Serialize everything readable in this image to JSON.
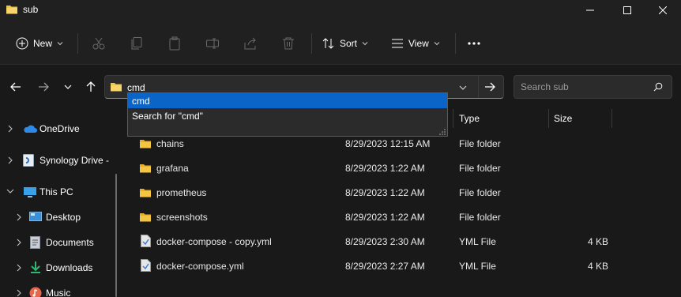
{
  "window": {
    "title": "sub",
    "minimize_icon": "minimize-icon",
    "maximize_icon": "maximize-icon",
    "close_icon": "close-icon"
  },
  "command_bar": {
    "new_label": "New",
    "sort_label": "Sort",
    "view_label": "View",
    "icons": [
      "plus-circle-icon",
      "cut-icon",
      "copy-icon",
      "paste-icon",
      "rename-icon",
      "share-icon",
      "delete-icon",
      "sort-icon",
      "view-icon",
      "more-icon"
    ]
  },
  "address_bar": {
    "value": "cmd",
    "suggestions": [
      "cmd",
      "Search for \"cmd\""
    ]
  },
  "search": {
    "placeholder": "Search sub"
  },
  "sidebar": {
    "items": [
      {
        "label": "OneDrive",
        "icon": "cloud-icon"
      },
      {
        "label": "Synology Drive -",
        "icon": "synology-icon"
      },
      {
        "label": "This PC",
        "icon": "monitor-icon"
      },
      {
        "label": "Desktop",
        "icon": "desktop-icon"
      },
      {
        "label": "Documents",
        "icon": "documents-icon"
      },
      {
        "label": "Downloads",
        "icon": "download-icon"
      },
      {
        "label": "Music",
        "icon": "music-icon"
      }
    ]
  },
  "columns": {
    "type": "Type",
    "size": "Size"
  },
  "files": [
    {
      "name": "chains",
      "date": "8/29/2023 12:15 AM",
      "type": "File folder",
      "size": ""
    },
    {
      "name": "grafana",
      "date": "8/29/2023 1:22 AM",
      "type": "File folder",
      "size": ""
    },
    {
      "name": "prometheus",
      "date": "8/29/2023 1:22 AM",
      "type": "File folder",
      "size": ""
    },
    {
      "name": "screenshots",
      "date": "8/29/2023 1:22 AM",
      "type": "File folder",
      "size": ""
    },
    {
      "name": "docker-compose - copy.yml",
      "date": "8/29/2023 2:30 AM",
      "type": "YML File",
      "size": "4 KB"
    },
    {
      "name": "docker-compose.yml",
      "date": "8/29/2023 2:27 AM",
      "type": "YML File",
      "size": "4 KB"
    }
  ],
  "colors": {
    "accent": "#0b64c8",
    "folder": "#f4c542",
    "background": "#191919"
  }
}
